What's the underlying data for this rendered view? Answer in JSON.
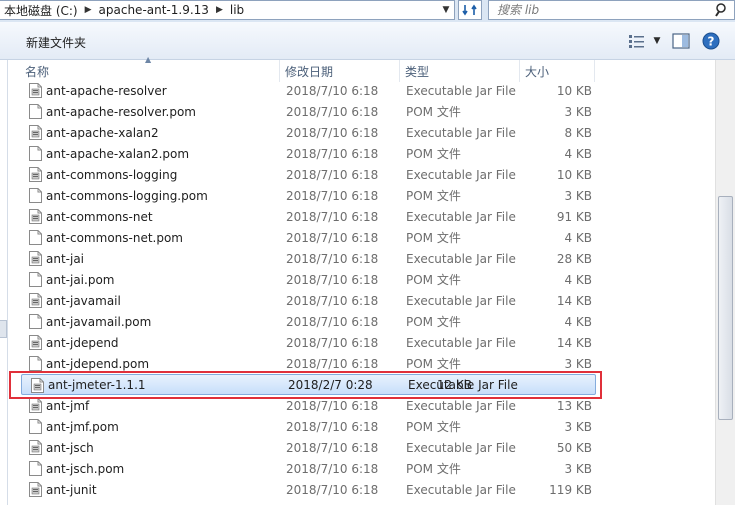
{
  "address": {
    "crumbs": [
      "本地磁盘 (C:)",
      "apache-ant-1.9.13",
      "lib"
    ]
  },
  "search": {
    "placeholder": "搜索 lib"
  },
  "toolbar": {
    "new_folder_label": "新建文件夹"
  },
  "columns": {
    "name": "名称",
    "date": "修改日期",
    "type": "类型",
    "size": "大小"
  },
  "files": [
    {
      "name": "ant-apache-resolver",
      "date": "2018/7/10 6:18",
      "type": "Executable Jar File",
      "size": "10 KB"
    },
    {
      "name": "ant-apache-resolver.pom",
      "date": "2018/7/10 6:18",
      "type": "POM 文件",
      "size": "3 KB"
    },
    {
      "name": "ant-apache-xalan2",
      "date": "2018/7/10 6:18",
      "type": "Executable Jar File",
      "size": "8 KB"
    },
    {
      "name": "ant-apache-xalan2.pom",
      "date": "2018/7/10 6:18",
      "type": "POM 文件",
      "size": "4 KB"
    },
    {
      "name": "ant-commons-logging",
      "date": "2018/7/10 6:18",
      "type": "Executable Jar File",
      "size": "10 KB"
    },
    {
      "name": "ant-commons-logging.pom",
      "date": "2018/7/10 6:18",
      "type": "POM 文件",
      "size": "3 KB"
    },
    {
      "name": "ant-commons-net",
      "date": "2018/7/10 6:18",
      "type": "Executable Jar File",
      "size": "91 KB"
    },
    {
      "name": "ant-commons-net.pom",
      "date": "2018/7/10 6:18",
      "type": "POM 文件",
      "size": "4 KB"
    },
    {
      "name": "ant-jai",
      "date": "2018/7/10 6:18",
      "type": "Executable Jar File",
      "size": "28 KB"
    },
    {
      "name": "ant-jai.pom",
      "date": "2018/7/10 6:18",
      "type": "POM 文件",
      "size": "4 KB"
    },
    {
      "name": "ant-javamail",
      "date": "2018/7/10 6:18",
      "type": "Executable Jar File",
      "size": "14 KB"
    },
    {
      "name": "ant-javamail.pom",
      "date": "2018/7/10 6:18",
      "type": "POM 文件",
      "size": "4 KB"
    },
    {
      "name": "ant-jdepend",
      "date": "2018/7/10 6:18",
      "type": "Executable Jar File",
      "size": "14 KB"
    },
    {
      "name": "ant-jdepend.pom",
      "date": "2018/7/10 6:18",
      "type": "POM 文件",
      "size": "3 KB"
    },
    {
      "name": "ant-jmeter-1.1.1",
      "date": "2018/2/7 0:28",
      "type": "Executable Jar File",
      "size": "12 KB",
      "selected": true
    },
    {
      "name": "ant-jmf",
      "date": "2018/7/10 6:18",
      "type": "Executable Jar File",
      "size": "13 KB"
    },
    {
      "name": "ant-jmf.pom",
      "date": "2018/7/10 6:18",
      "type": "POM 文件",
      "size": "3 KB"
    },
    {
      "name": "ant-jsch",
      "date": "2018/7/10 6:18",
      "type": "Executable Jar File",
      "size": "50 KB"
    },
    {
      "name": "ant-jsch.pom",
      "date": "2018/7/10 6:18",
      "type": "POM 文件",
      "size": "3 KB"
    },
    {
      "name": "ant-junit",
      "date": "2018/7/10 6:18",
      "type": "Executable Jar File",
      "size": "119 KB"
    }
  ],
  "colors": {
    "selection_border": "#84acdd",
    "highlight_box": "#e0303a",
    "toolbar_bg": "#e3ebf6"
  },
  "icons": {
    "jar": "jar-file-icon",
    "pom": "pom-file-icon"
  }
}
